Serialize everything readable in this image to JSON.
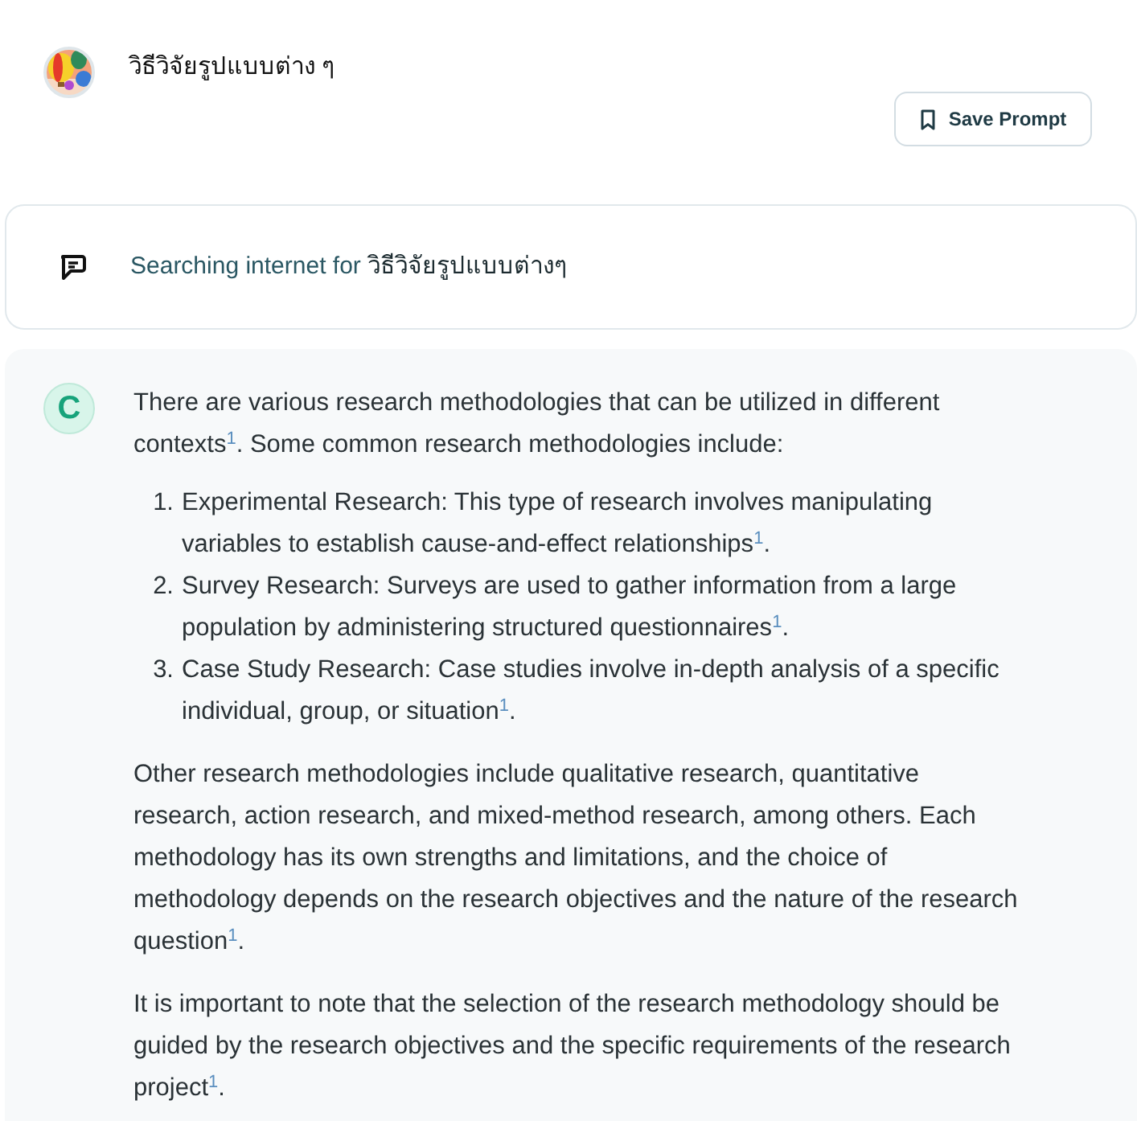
{
  "prompt": {
    "title": "วิธีวิจัยรูปแบบต่าง ๆ",
    "save_button": "Save Prompt"
  },
  "search_status": {
    "label": "Searching internet for",
    "query": "วิธีวิจัยรูปแบบต่างๆ"
  },
  "answer": {
    "avatar_letter": "C",
    "intro": "There are various research methodologies that can be utilized in different contexts$^{1}$. Some common research methodologies include:",
    "list": [
      {
        "number": "1.",
        "text": "Experimental Research: This type of research involves manipulating variables to establish cause-and-effect relationships$^{1}$."
      },
      {
        "number": "2.",
        "text": "Survey Research: Surveys are used to gather information from a large population by administering structured questionnaires$^{1}$."
      },
      {
        "number": "3.",
        "text": "Case Study Research: Case studies involve in-depth analysis of a specific individual, group, or situation$^{1}$."
      }
    ],
    "paragraphs": [
      "Other research methodologies include qualitative research, quantitative research, action research, and mixed-method research, among others. Each methodology has its own strengths and limitations, and the choice of methodology depends on the research objectives and the nature of the research question$^{1}$.",
      "It is important to note that the selection of the research methodology should be guided by the research objectives and the specific requirements of the research project$^{1}$."
    ]
  }
}
